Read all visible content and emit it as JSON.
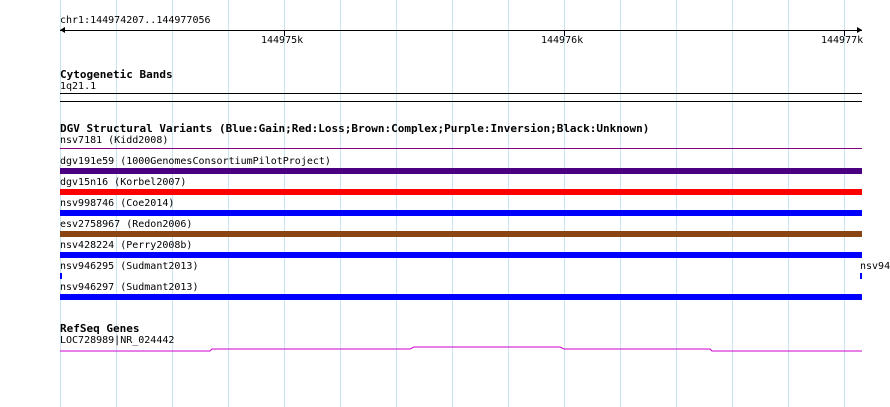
{
  "location": "chr1:144974207..144977056",
  "ruler": {
    "ticks": [
      "144975k",
      "144976k",
      "144977k"
    ]
  },
  "tracks": {
    "cytobands": {
      "title": "Cytogenetic Bands",
      "band": "1q21.1"
    },
    "dgv": {
      "title": "DGV Structural Variants (Blue:Gain;Red:Loss;Brown:Complex;Purple:Inversion;Black:Unknown)",
      "features": [
        {
          "label": "nsv7181 (Kidd2008)",
          "color": "#800080",
          "kind": "thin"
        },
        {
          "label": "dgv191e59 (1000GenomesConsortiumPilotProject)",
          "color": "#4b0082",
          "kind": "bar"
        },
        {
          "label": "dgv15n16 (Korbel2007)",
          "color": "#ff0000",
          "kind": "bar"
        },
        {
          "label": "nsv998746 (Coe2014)",
          "color": "#0000ff",
          "kind": "bar"
        },
        {
          "label": "esv2758967 (Redon2006)",
          "color": "#8b4513",
          "kind": "bar"
        },
        {
          "label": "nsv428224 (Perry2008b)",
          "color": "#0000ff",
          "kind": "bar"
        },
        {
          "label": "nsv946295 (Sudmant2013)",
          "color": "#0000ff",
          "kind": "split"
        },
        {
          "label": "nsv946297 (Sudmant2013)",
          "color": "#0000ff",
          "kind": "bar"
        }
      ],
      "split_right_label": "nsv94"
    },
    "refseq": {
      "title": "RefSeq Genes",
      "gene": "LOC728989|NR_024442",
      "color": "#cc00cc"
    }
  }
}
